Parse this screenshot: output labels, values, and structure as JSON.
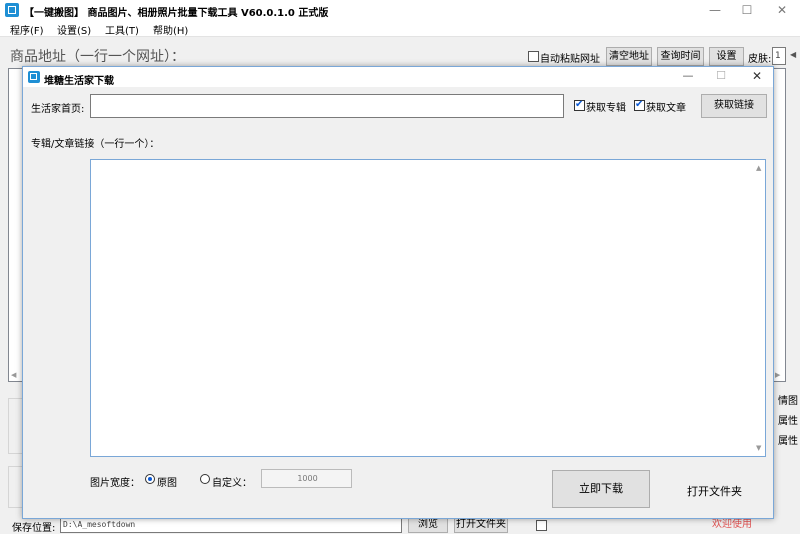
{
  "window": {
    "title": "【一键搬图】 商品图片、相册照片批量下载工具 V60.0.1.0 正式版",
    "min_icon": "—",
    "max_icon": "☐",
    "close_icon": "✕"
  },
  "menu": [
    "程序(F)",
    "设置(S)",
    "工具(T)",
    "帮助(H)"
  ],
  "toolbar": {
    "address_label": "商品地址（一行一个网址）：",
    "auto_paste_label": "自动粘贴网址",
    "clear_label": "清空地址",
    "query_time_label": "查询时间",
    "settings_label": "设置",
    "skin_label": "皮肤:",
    "skin_value": "1"
  },
  "background_fragments": {
    "right_1": "情图",
    "right_2": "属性",
    "right_3": "属性",
    "bottom_right_text": "欢迎使用"
  },
  "bottom": {
    "save_label": "保存位置:",
    "save_path": "D:\\A_mesoftdown",
    "browse_label": "浏览",
    "open_folder_label": "打开文件夹"
  },
  "dialog": {
    "title": "堆糖生活家下载",
    "home_label": "生活家首页:",
    "home_value": "",
    "get_albums_label": "获取专辑",
    "get_albums_checked": true,
    "get_articles_label": "获取文章",
    "get_articles_checked": true,
    "get_links_label": "获取链接",
    "links_label": "专辑/文章链接（一行一个）：",
    "links_value": "",
    "width_label": "图片宽度：",
    "original_label": "原图",
    "original_selected": true,
    "custom_label": "自定义：",
    "custom_selected": false,
    "custom_value": "1000",
    "download_label": "立即下载",
    "open_folder_label": "打开文件夹",
    "close_icon": "✕",
    "max_icon": "☐",
    "min_icon": "—"
  },
  "colors": {
    "accent": "#0d5bd6",
    "icon_blue": "#1e8fd4",
    "dialog_border": "#7aa7d7"
  }
}
